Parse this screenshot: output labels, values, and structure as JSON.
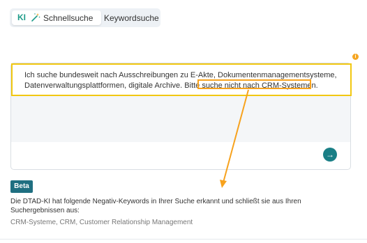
{
  "tabs": {
    "ki_label": "KI",
    "quick_search": "Schnellsuche",
    "keyword_search": "Keywordsuche"
  },
  "search": {
    "query_part1": "Ich suche bundesweit nach Ausschreibungen zu E-Akte, Dokumentenmanagementsysteme, Datenverwaltungsplattformen, digitale Archive. Bitte ",
    "query_part2": "suche nicht nach CRM-Systemen.",
    "submit_icon": "→"
  },
  "info_icon": "i",
  "beta_label": "Beta",
  "negative_info": "Die DTAD-KI hat folgende Negativ-Keywords in Ihrer Suche erkannt und schließt sie aus Ihren Suchergebnissen aus:",
  "negative_keywords": "CRM-Systeme, CRM, Customer Relationship Management",
  "colors": {
    "accent": "#1f9c8a",
    "highlight_yellow": "#f2c811",
    "annotation_orange": "#f7a21d",
    "submit_button": "#1a7f86",
    "beta_badge": "#1f6f81"
  }
}
